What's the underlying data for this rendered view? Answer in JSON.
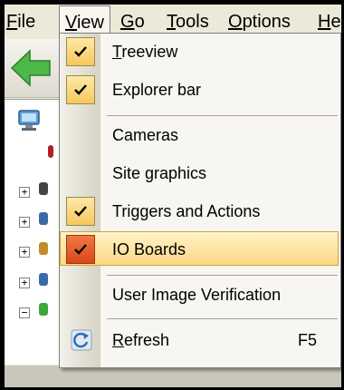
{
  "menubar": {
    "items": [
      {
        "label_u": "F",
        "label_rest": "ile",
        "active": false
      },
      {
        "label_u": "V",
        "label_rest": "iew",
        "active": true
      },
      {
        "label_u": "G",
        "label_rest": "o",
        "active": false
      },
      {
        "label_u": "T",
        "label_rest": "ools",
        "active": false
      },
      {
        "label_u": "O",
        "label_rest": "ptions",
        "active": false
      },
      {
        "label_u": "H",
        "label_rest": "e",
        "active": false
      }
    ]
  },
  "view_menu": {
    "items": [
      {
        "label_u": "T",
        "label_rest": "reeview",
        "checked": true,
        "highlighted": false
      },
      {
        "label_u": "",
        "label_rest": "Explorer bar",
        "checked": true,
        "highlighted": false
      },
      {
        "label_u": "",
        "label_rest": "Cameras",
        "checked": false,
        "highlighted": false
      },
      {
        "label_u": "",
        "label_rest": "Site graphics",
        "checked": false,
        "highlighted": false
      },
      {
        "label_u": "",
        "label_rest": "Triggers and Actions",
        "checked": true,
        "highlighted": false
      },
      {
        "label_u": "",
        "label_rest": "IO Boards",
        "checked": true,
        "highlighted": true
      },
      {
        "label_u": "",
        "label_rest": "User Image Verification",
        "checked": false,
        "highlighted": false
      },
      {
        "label_u": "R",
        "label_rest": "efresh",
        "shortcut": "F5",
        "icon": "refresh-icon"
      }
    ]
  },
  "tree": {
    "expanders": [
      "+",
      "+",
      "+",
      "+",
      "−"
    ]
  },
  "colors": {
    "check_bg": "#f5c85c",
    "highlight_check_bg": "#d9461a",
    "highlight_row": "#fbd885",
    "back_arrow": "#4cb848"
  }
}
